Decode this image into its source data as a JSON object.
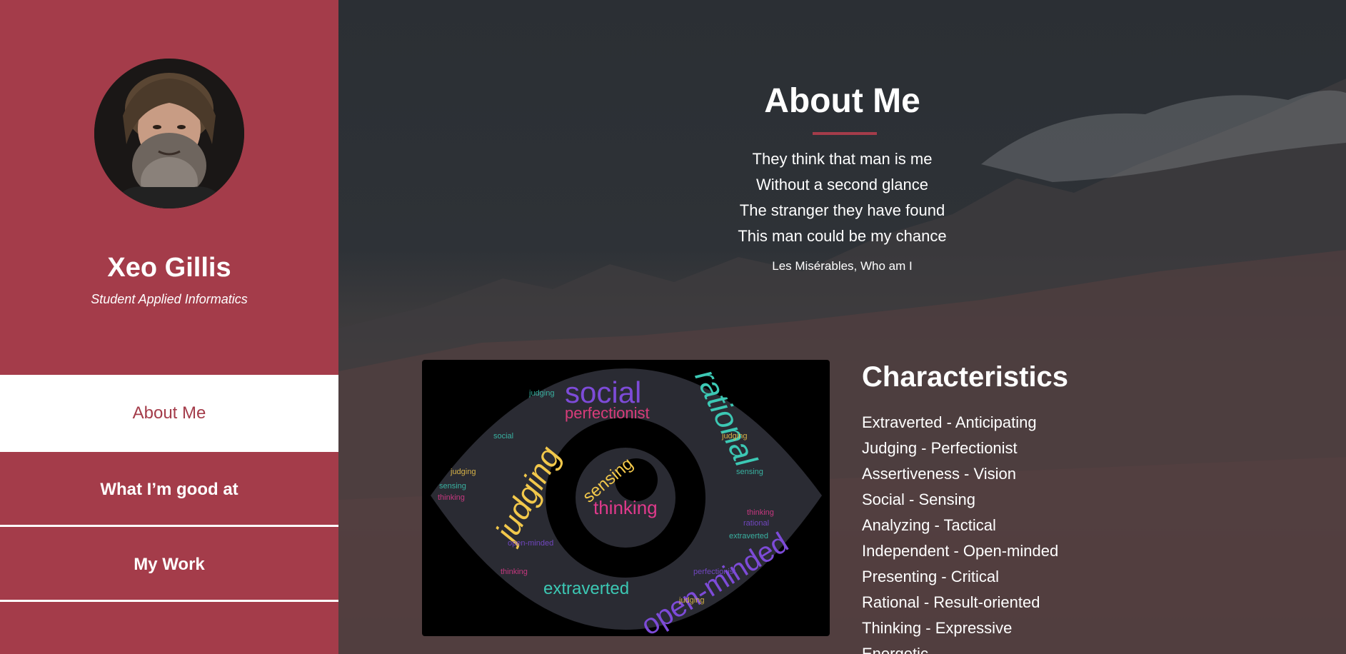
{
  "profile": {
    "name": "Xeo Gillis",
    "role": "Student Applied Informatics"
  },
  "nav": {
    "items": [
      {
        "label": "About Me",
        "active": true
      },
      {
        "label": "What I’m good at",
        "active": false
      },
      {
        "label": "My Work",
        "active": false
      }
    ]
  },
  "about": {
    "title": "About Me",
    "poem": [
      "They think that man is me",
      "Without a second glance",
      "The stranger they have found",
      "This man could be my chance"
    ],
    "source": "Les Misérables, Who am I"
  },
  "characteristics": {
    "title": "Characteristics",
    "items": [
      "Extraverted - Anticipating",
      "Judging - Perfectionist",
      "Assertiveness - Vision",
      "Social - Sensing",
      "Analyzing - Tactical",
      "Independent - Open-minded",
      "Presenting - Critical",
      "Rational - Result-oriented",
      "Thinking - Expressive",
      "Energetic"
    ]
  },
  "word_cloud": {
    "words": [
      "social",
      "perfectionist",
      "rational",
      "judging",
      "thinking",
      "sensing",
      "open-minded",
      "extraverted"
    ]
  },
  "colors": {
    "accent": "#a43c4a",
    "sidebar": "#a43c4a",
    "text": "#ffffff"
  }
}
